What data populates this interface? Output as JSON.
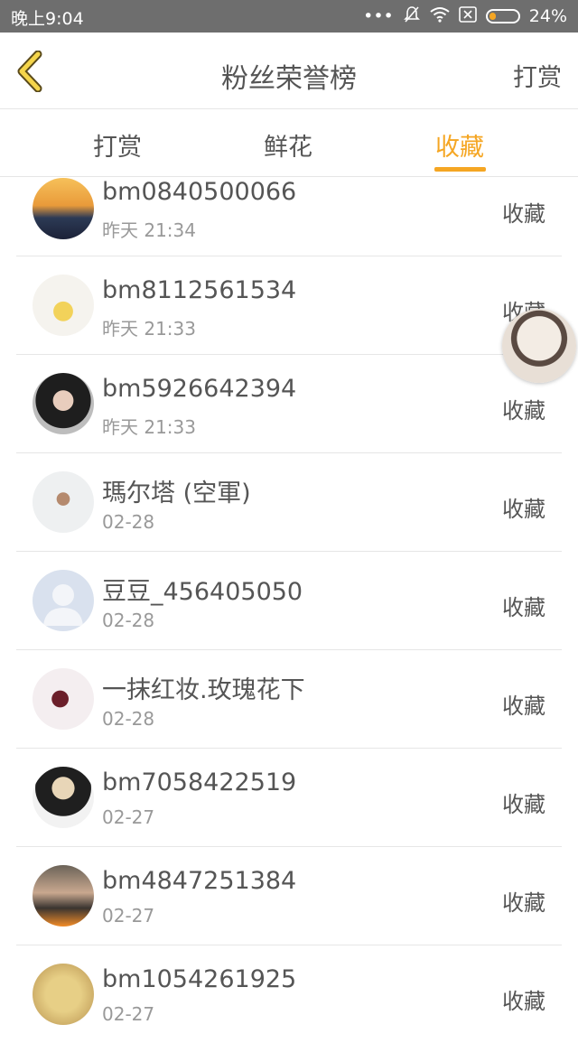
{
  "status": {
    "time": "晚上9:04",
    "battery": "24%",
    "battery_level": 0.24
  },
  "header": {
    "title": "粉丝荣誉榜",
    "action": "打赏"
  },
  "tabs": [
    {
      "label": "打赏",
      "active": false
    },
    {
      "label": "鲜花",
      "active": false
    },
    {
      "label": "收藏",
      "active": true
    }
  ],
  "colors": {
    "accent": "#f5a623",
    "text": "#555555",
    "subtext": "#999999",
    "statusbar": "#6e6e6e"
  },
  "rows": [
    {
      "name": "bm0840500066",
      "date": "昨天 21:34",
      "action": "收藏",
      "avatar": "sunset-avatar"
    },
    {
      "name": "bm8112561534",
      "date": "昨天 21:33",
      "action": "收藏",
      "avatar": "dancer-avatar"
    },
    {
      "name": "bm5926642394",
      "date": "昨天 21:33",
      "action": "收藏",
      "avatar": "girl-photo-avatar"
    },
    {
      "name": "瑪尔塔 (空軍)",
      "date": "02-28",
      "action": "收藏",
      "avatar": "plane-avatar"
    },
    {
      "name": "豆豆_456405050",
      "date": "02-28",
      "action": "收藏",
      "avatar": "default-user-avatar"
    },
    {
      "name": "一抹红妆.玫瑰花下",
      "date": "02-28",
      "action": "收藏",
      "avatar": "anime-red-avatar"
    },
    {
      "name": "bm7058422519",
      "date": "02-27",
      "action": "收藏",
      "avatar": "anime-boy-avatar"
    },
    {
      "name": "bm4847251384",
      "date": "02-27",
      "action": "收藏",
      "avatar": "photo-avatar"
    },
    {
      "name": "bm1054261925",
      "date": "02-27",
      "action": "收藏",
      "avatar": "sand-heart-avatar"
    }
  ]
}
